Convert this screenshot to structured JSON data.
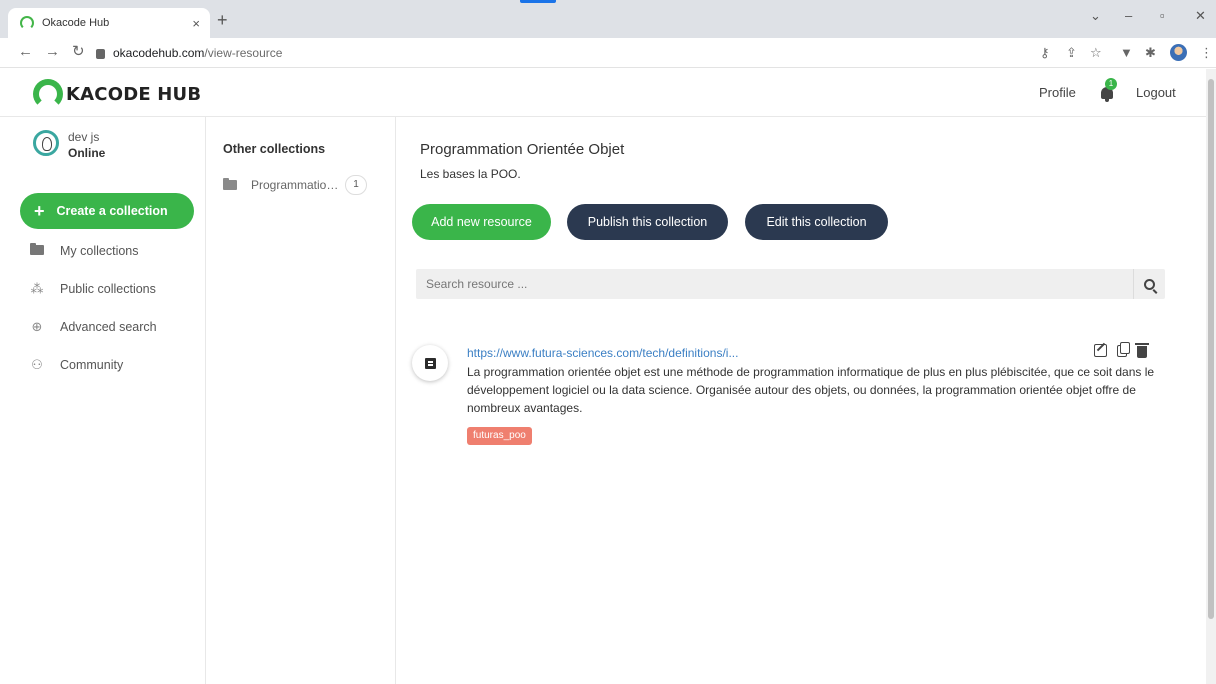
{
  "browser": {
    "tab_title": "Okacode Hub",
    "tab_close": "×",
    "new_tab": "+",
    "url_host": "okacodehub.com",
    "url_path": "/view-resource"
  },
  "header": {
    "logo_text": "KACODE HUB",
    "profile": "Profile",
    "notifications_count": "1",
    "logout": "Logout"
  },
  "user": {
    "name": "dev js",
    "status": "Online"
  },
  "sidebar": {
    "create_label": "Create a collection",
    "items": [
      {
        "label": "My collections",
        "icon": "folder-icon"
      },
      {
        "label": "Public collections",
        "icon": "cubes-icon"
      },
      {
        "label": "Advanced search",
        "icon": "search-plus-icon"
      },
      {
        "label": "Community",
        "icon": "users-icon"
      }
    ]
  },
  "other_collections": {
    "heading": "Other collections",
    "items": [
      {
        "label": "Programmation O...",
        "count": "1"
      }
    ]
  },
  "collection": {
    "title": "Programmation Orientée Objet",
    "description": "Les bases la POO.",
    "buttons": {
      "add": "Add new resource",
      "publish": "Publish this collection",
      "edit": "Edit this collection"
    },
    "search_placeholder": "Search resource ..."
  },
  "resource": {
    "link": "https://www.futura-sciences.com/tech/definitions/i...",
    "text": "La programmation orientée objet est une méthode de programmation informatique de plus en plus plébiscitée, que ce soit dans le développement logiciel ou la data science. Organisée autour des objets, ou données, la programmation orientée objet offre de nombreux avantages.",
    "tag": "futuras_poo"
  },
  "colors": {
    "brand_green": "#3ab54a",
    "navy": "#2b3950",
    "tag": "#ef7f6f",
    "link": "#3b7fc4"
  }
}
